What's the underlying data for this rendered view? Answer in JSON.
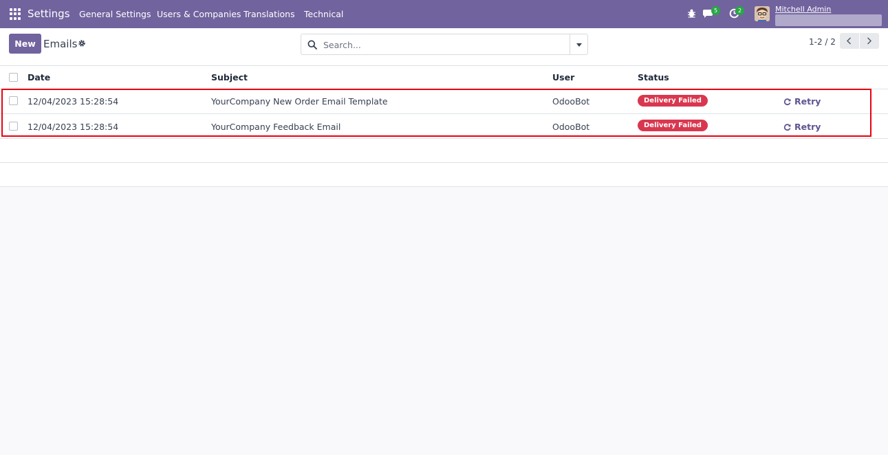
{
  "navbar": {
    "app_title": "Settings",
    "menu": [
      "General Settings",
      "Users & Companies",
      "Translations",
      "Technical"
    ],
    "messages_count": "5",
    "activities_count": "2",
    "user_name": "Mitchell Admin"
  },
  "control_panel": {
    "new_label": "New",
    "title": "Emails",
    "search_placeholder": "Search...",
    "pager": "1-2 / 2"
  },
  "table": {
    "headers": {
      "date": "Date",
      "subject": "Subject",
      "user": "User",
      "status": "Status"
    },
    "rows": [
      {
        "date": "12/04/2023 15:28:54",
        "subject": "YourCompany New Order Email Template",
        "user": "OdooBot",
        "status": "Delivery Failed",
        "action": "Retry"
      },
      {
        "date": "12/04/2023 15:28:54",
        "subject": "YourCompany Feedback Email",
        "user": "OdooBot",
        "status": "Delivery Failed",
        "action": "Retry"
      }
    ]
  },
  "colors": {
    "brand": "#71639e",
    "status_failed": "#d9374f",
    "highlight": "#e8000f",
    "badge_green": "#28a745"
  }
}
